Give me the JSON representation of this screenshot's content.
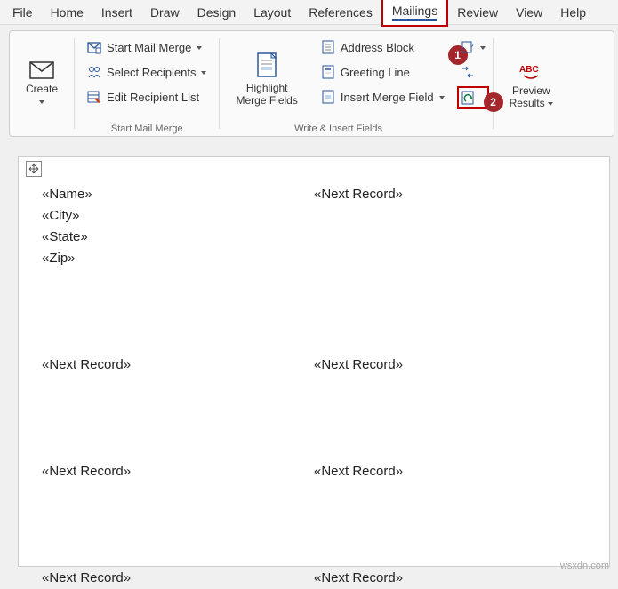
{
  "tabs": [
    "File",
    "Home",
    "Insert",
    "Draw",
    "Design",
    "Layout",
    "References",
    "Mailings",
    "Review",
    "View",
    "Help"
  ],
  "activeTab": "Mailings",
  "ribbon": {
    "create": {
      "label": "Create"
    },
    "startMailMerge": {
      "items": [
        "Start Mail Merge",
        "Select Recipients",
        "Edit Recipient List"
      ],
      "groupLabel": "Start Mail Merge"
    },
    "highlight": {
      "line1": "Highlight",
      "line2": "Merge Fields"
    },
    "writeInsert": {
      "addressBlock": "Address Block",
      "greetingLine": "Greeting Line",
      "insertMergeField": "Insert Merge Field",
      "groupLabel": "Write & Insert Fields"
    },
    "preview": {
      "line1": "Preview",
      "line2": "Results"
    }
  },
  "doc": {
    "fields": [
      "«Name»",
      "«City»",
      "«State»",
      "«Zip»"
    ],
    "nextRecord": "«Next Record»"
  },
  "badges": {
    "one": "1",
    "two": "2"
  },
  "watermark": "wsxdn.com"
}
